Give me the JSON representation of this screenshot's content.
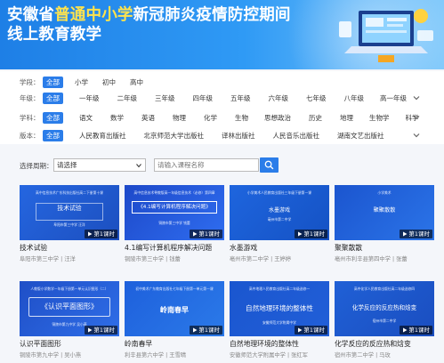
{
  "banner": {
    "title_prefix": "安徽省",
    "title_highlight": "普通中小学",
    "title_suffix": "新冠肺炎疫情防控期间",
    "title_line2": "线上教育教学"
  },
  "filters": [
    {
      "label": "学段：",
      "options": [
        "全部",
        "小学",
        "初中",
        "高中"
      ]
    },
    {
      "label": "年级：",
      "options": [
        "全部",
        "一年级",
        "二年级",
        "三年级",
        "四年级",
        "五年级",
        "六年级",
        "七年级",
        "八年级",
        "高一年级"
      ]
    },
    {
      "label": "学科：",
      "options": [
        "全部",
        "语文",
        "数学",
        "英语",
        "物理",
        "化学",
        "生物",
        "思想政治",
        "历史",
        "地理",
        "生物学",
        "科学"
      ]
    },
    {
      "label": "版本：",
      "options": [
        "全部",
        "人民教育出版社",
        "北京师范大学出版社",
        "译林出版社",
        "人民音乐出版社",
        "湖南文艺出版社"
      ]
    }
  ],
  "search": {
    "label": "选择周期：",
    "select_value": "请选择",
    "input_placeholder": "请输入课程名称"
  },
  "cards": [
    {
      "title": "技术试验",
      "meta": "阜阳市第三中学 | 汪洋",
      "badge": "第1课时",
      "thumb_top": "高中信息技术广东科技出版社高二下册第十课",
      "thumb_main": "技术试验",
      "thumb_sub": "阜阳市第三中学 汪洋"
    },
    {
      "title": "4.1编写计算机程序解决问题",
      "meta": "铜陵市第三中学 | 钱蕾",
      "badge": "第1课时",
      "thumb_top": "高中信息技术粤教版高一年级信息技术（必修）第四章",
      "thumb_main": "《4.1编写计算机程序解决问题》",
      "thumb_sub": "铜陵市第三中学 钱蕾"
    },
    {
      "title": "水墨游戏",
      "meta": "亳州市第二中学 | 王婷婷",
      "badge": "第1课时",
      "thumb_top": "小学美术人民教育出版社三年级下册第一课",
      "thumb_main": "水墨游戏",
      "thumb_sub": "亳州市第二中学"
    },
    {
      "title": "聚聚散散",
      "meta": "亳州市利辛县第四中学 | 张蕾",
      "badge": "第1课时",
      "thumb_top": "小学美术",
      "thumb_main": "聚聚散散",
      "thumb_sub": ""
    },
    {
      "title": "认识平面图形",
      "meta": "铜陵市第九中学 | 吴小燕",
      "badge": "第1课时",
      "thumb_top": "人教版小学数学一年级下册第一单元认识图形（二）",
      "thumb_main": "《认识平面图形》",
      "thumb_sub": "铜陵市第九中学 吴小燕"
    },
    {
      "title": "岭南春早",
      "meta": "利辛县第六中学 | 王雪晴",
      "badge": "第1课时",
      "thumb_top": "初中美术广东教育出版社七年级下册第一单元第一课",
      "thumb_main": "岭南春早",
      "thumb_sub": ""
    },
    {
      "title": "自然地理环境的整体性",
      "meta": "安徽师范大学附属中学 | 张红军",
      "badge": "第1课时",
      "thumb_top": "高中地理人民教育出版社高二年级选修一",
      "thumb_main": "自然地理环境的整体性",
      "thumb_sub": "安徽师范大学附属中学"
    },
    {
      "title": "化学反应的反应热和焓变",
      "meta": "宿州市第二中学 | 马玫",
      "badge": "第1课时",
      "thumb_top": "高中化学人民教育出版社高二年级选修四",
      "thumb_main": "化学反应的反应热和焓变",
      "thumb_sub": "宿州市第二中学"
    }
  ]
}
